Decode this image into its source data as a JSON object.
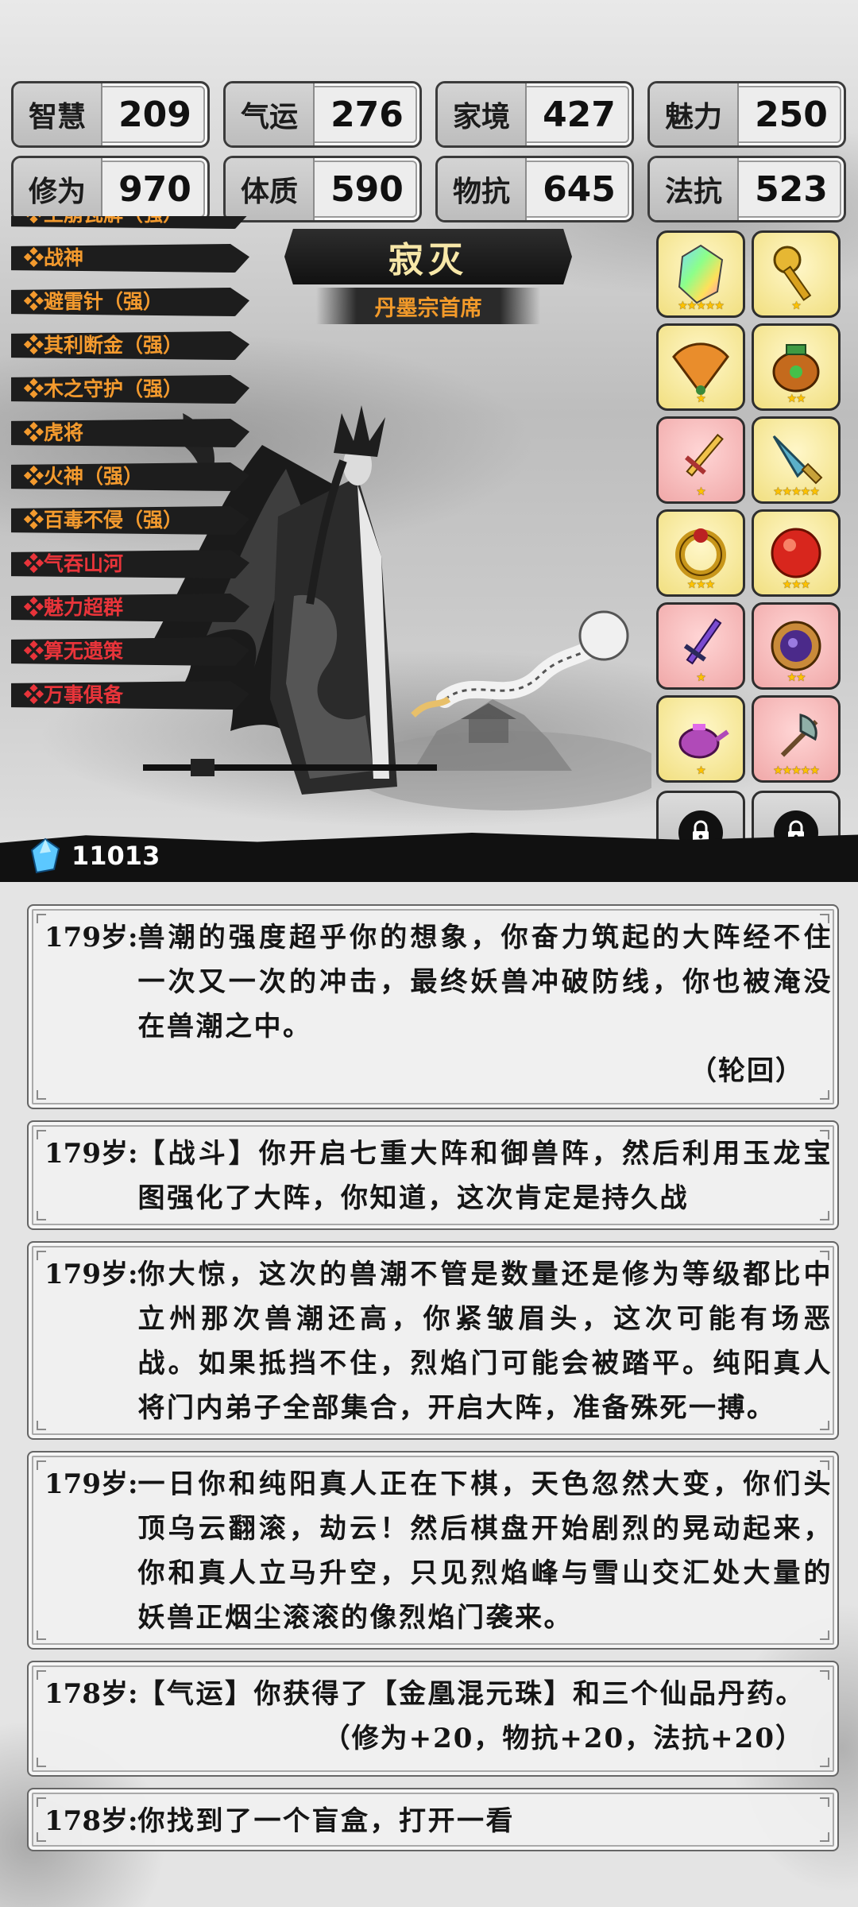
{
  "stats": [
    {
      "label": "智慧",
      "value": "209"
    },
    {
      "label": "气运",
      "value": "276"
    },
    {
      "label": "家境",
      "value": "427"
    },
    {
      "label": "魅力",
      "value": "250"
    },
    {
      "label": "修为",
      "value": "970"
    },
    {
      "label": "体质",
      "value": "590"
    },
    {
      "label": "物抗",
      "value": "645"
    },
    {
      "label": "法抗",
      "value": "523"
    }
  ],
  "traits": {
    "partial": "❖土崩瓦解（强）",
    "items": [
      {
        "label": "❖战神",
        "color": "orange"
      },
      {
        "label": "❖避雷针（强）",
        "color": "orange"
      },
      {
        "label": "❖其利断金（强）",
        "color": "orange"
      },
      {
        "label": "❖木之守护（强）",
        "color": "orange"
      },
      {
        "label": "❖虎将",
        "color": "orange"
      },
      {
        "label": "❖火神（强）",
        "color": "orange"
      },
      {
        "label": "❖百毒不侵（强）",
        "color": "orange"
      },
      {
        "label": "❖气吞山河",
        "color": "red"
      },
      {
        "label": "❖魅力超群",
        "color": "red"
      },
      {
        "label": "❖算无遗策",
        "color": "red"
      },
      {
        "label": "❖万事俱备",
        "color": "red"
      }
    ]
  },
  "character": {
    "name": "寂灭",
    "title": "丹墨宗首席"
  },
  "items": [
    {
      "icon": "rainbow-crystal-icon",
      "bg": "yellow",
      "stars": "★★★★★"
    },
    {
      "icon": "golden-key-icon",
      "bg": "yellow",
      "stars": "★"
    },
    {
      "icon": "folding-fan-icon",
      "bg": "yellow",
      "stars": "★"
    },
    {
      "icon": "bronze-cauldron-icon",
      "bg": "yellow",
      "stars": "★★"
    },
    {
      "icon": "golden-sword-icon",
      "bg": "pink",
      "stars": "★"
    },
    {
      "icon": "jade-blade-icon",
      "bg": "yellow",
      "stars": "★★★★★"
    },
    {
      "icon": "gold-ring-icon",
      "bg": "yellow",
      "stars": "★★★"
    },
    {
      "icon": "red-pearl-icon",
      "bg": "yellow",
      "stars": "★★★"
    },
    {
      "icon": "purple-sword-icon",
      "bg": "pink",
      "stars": "★"
    },
    {
      "icon": "mystic-mirror-icon",
      "bg": "pink",
      "stars": "★★"
    },
    {
      "icon": "purple-teapot-icon",
      "bg": "yellow",
      "stars": "★"
    },
    {
      "icon": "battle-axe-icon",
      "bg": "pink",
      "stars": "★★★★★"
    }
  ],
  "gems": {
    "value": "11013"
  },
  "log": [
    {
      "age": "179岁:",
      "text": "兽潮的强度超乎你的想象，你奋力筑起的大阵经不住一次又一次的冲击，最终妖兽冲破防线，你也被淹没在兽潮之中。",
      "note": "（轮回）"
    },
    {
      "age": "179岁:",
      "text": "【战斗】你开启七重大阵和御兽阵，然后利用玉龙宝图强化了大阵，你知道，这次肯定是持久战",
      "note": ""
    },
    {
      "age": "179岁:",
      "text": "你大惊，这次的兽潮不管是数量还是修为等级都比中立州那次兽潮还高，你紧皱眉头，这次可能有场恶战。如果抵挡不住，烈焰门可能会被踏平。纯阳真人将门内弟子全部集合，开启大阵，准备殊死一搏。",
      "note": ""
    },
    {
      "age": "179岁:",
      "text": "一日你和纯阳真人正在下棋，天色忽然大变，你们头顶乌云翻滚，劫云！然后棋盘开始剧烈的晃动起来，你和真人立马升空，只见烈焰峰与雪山交汇处大量的妖兽正烟尘滚滚的像烈焰门袭来。",
      "note": ""
    },
    {
      "age": "178岁:",
      "text": "【气运】你获得了【金凰混元珠】和三个仙品丹药。",
      "note": "（修为+20，物抗+20，法抗+20）"
    },
    {
      "age": "178岁:",
      "text": "你找到了一个盲盒，打开一看",
      "note": ""
    }
  ]
}
